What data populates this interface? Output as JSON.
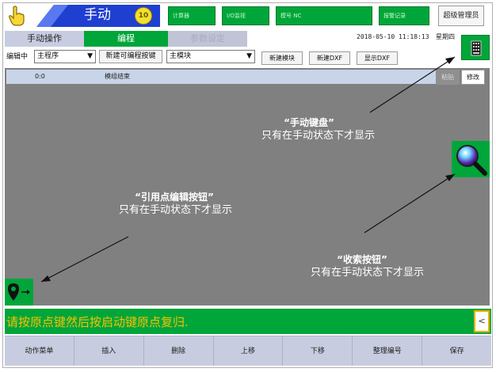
{
  "header": {
    "mode_label": "手动",
    "mode_badge": "10",
    "calculator_label": "计算器",
    "io_monitor_label": "I/O监视",
    "model_label": "模号 NC",
    "alarm_log_label": "报警记录",
    "user_label": "超级管理员",
    "blank_label": ""
  },
  "tabs": {
    "manual": "手动操作",
    "program": "编程",
    "params": "参数设定"
  },
  "clock": {
    "datetime": "2018-05-10  11:18:13",
    "weekday": "星期四"
  },
  "toolbar": {
    "editing_label": "编辑中",
    "program_select": "主程序",
    "new_programmable_button": "新建可编程按键",
    "module_select": "主模块",
    "new_module": "新建模块",
    "new_dxf": "新建DXF",
    "show_dxf": "显示DXF"
  },
  "program_row": {
    "index": "0:0",
    "text": "模组结束",
    "paste": "粘贴",
    "modify": "修改"
  },
  "annotations": {
    "keyboard": {
      "title": "“手动键盘”",
      "sub": "只有在手动状态下才显示"
    },
    "reference_point": {
      "title": "“引用点编辑按钮”",
      "sub": "只有在手动状态下才显示"
    },
    "search": {
      "title": "“收索按钮”",
      "sub": "只有在手动状态下才显示"
    }
  },
  "status": {
    "message": "请按原点键然后按启动键原点复归.",
    "collapse_glyph": "<"
  },
  "bottom_menu": [
    "动作菜单",
    "插入",
    "删除",
    "上移",
    "下移",
    "整理编号",
    "保存"
  ],
  "colors": {
    "accent_green": "#00a63a",
    "mode_blue": "#1f3fd0",
    "status_yellow": "#f8c000",
    "work_gray": "#808080"
  }
}
